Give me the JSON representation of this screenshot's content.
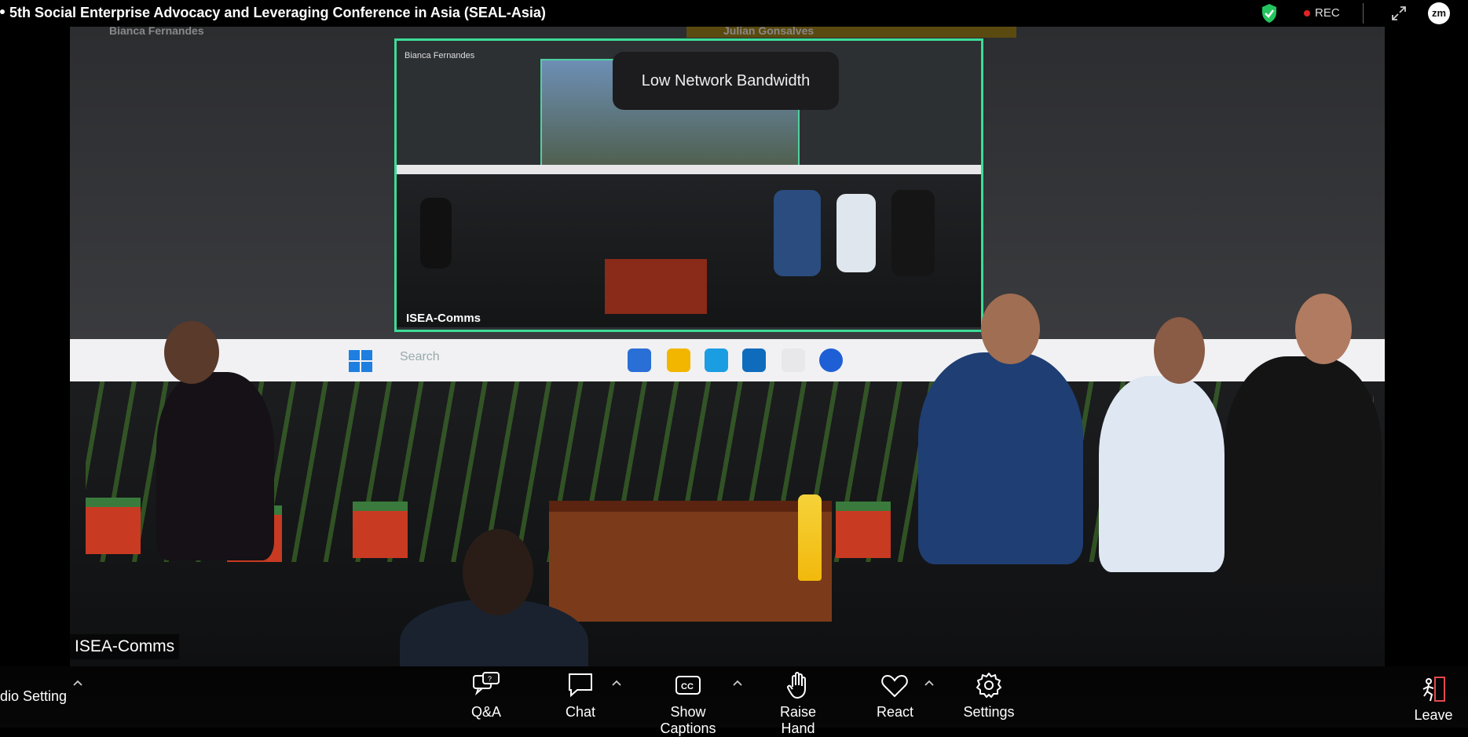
{
  "window": {
    "title": "5th Social Enterprise Advocacy and Leveraging Conference in Asia (SEAL-Asia)",
    "rec_label": "REC",
    "zoom_badge": "zm"
  },
  "video": {
    "ghost_names": [
      "Bianca Fernandes",
      "Julian Gonsalves"
    ],
    "inner_share_label": "Bianca Fernandes",
    "inner_speaker_name": "ISEA-Comms",
    "taskbar_search": "Search",
    "speaker_name": "ISEA-Comms"
  },
  "notification": {
    "text": "Low Network Bandwidth"
  },
  "toolbar": {
    "audio_setting": "dio Setting",
    "qa": "Q&A",
    "chat": "Chat",
    "captions": "Show Captions",
    "raise_hand": "Raise Hand",
    "react": "React",
    "settings": "Settings",
    "leave": "Leave"
  },
  "colors": {
    "active_speaker_border": "#3ddc97",
    "rec_dot": "#e02424",
    "leave_red": "#e5484d",
    "shield_green": "#22c55e"
  }
}
